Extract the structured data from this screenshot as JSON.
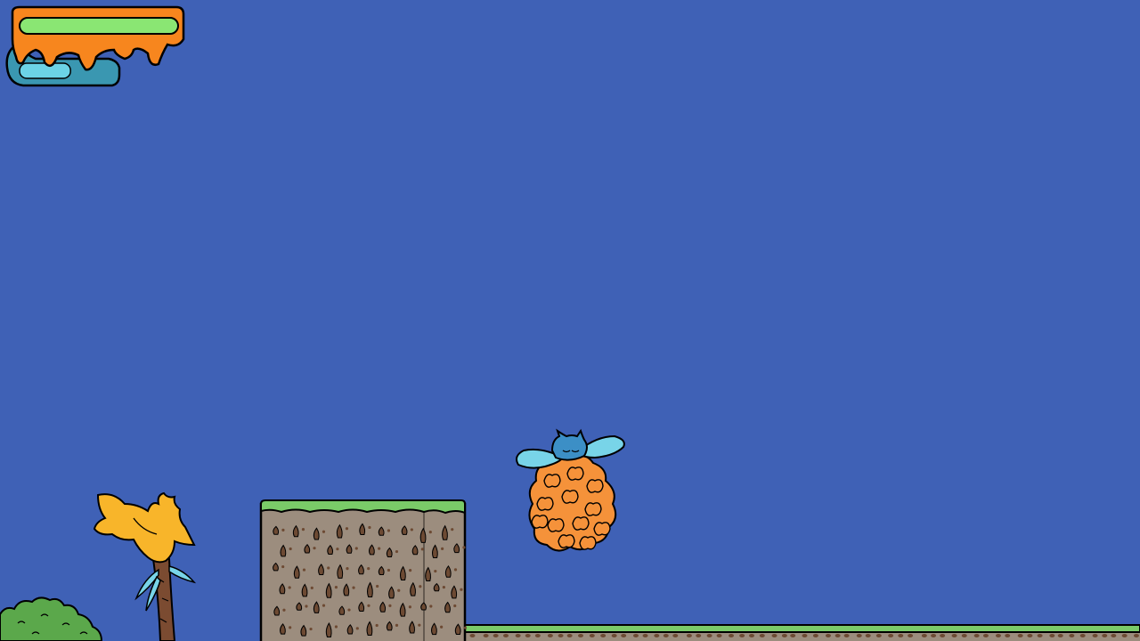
{
  "game": {
    "colors": {
      "sky": "#3F61B6",
      "health_fill": "#8AE673",
      "health_frame": "#F7861E",
      "mana_fill": "#6CD3E6",
      "mana_frame": "#3A97B1",
      "dirt": "#9C8D7E",
      "dirt_dark": "#6D4A33",
      "grass": "#7ACB68",
      "bush": "#5BA84B",
      "tree_leaves": "#F8B52A",
      "tree_trunk": "#7B4B31",
      "player_body": "#3C8FC6",
      "player_wings": "#78D4E8",
      "enemy_orange": "#F5923A",
      "outline": "#000000"
    },
    "hud": {
      "health_level": 1.0,
      "mana_level": 0.55
    },
    "entities": {
      "player": "winged-blue-creature",
      "enemy": "orange-slime-cluster",
      "tree": "yellow-bird-tree",
      "bush": "green-bush"
    }
  }
}
